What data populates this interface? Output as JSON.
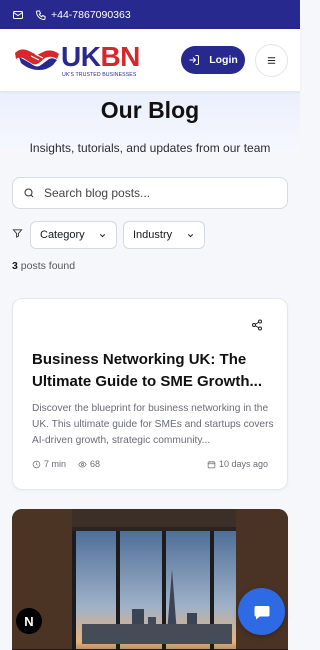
{
  "topbar": {
    "phone": "+44-7867090363",
    "icons": [
      "mail-icon",
      "phone-icon"
    ]
  },
  "header": {
    "logo_text_uk": "UK",
    "logo_text_bn": "BN",
    "logo_tagline": "UK'S TRUSTED BUSINESSES",
    "login_label": "Login",
    "menu_icon": "hamburger-icon"
  },
  "hero": {
    "title": "Our Blog",
    "subtitle": "Insights, tutorials, and updates from our team"
  },
  "search": {
    "placeholder": "Search blog posts...",
    "value": ""
  },
  "filters": {
    "category_label": "Category",
    "industry_label": "Industry"
  },
  "results": {
    "count": "3",
    "label": "posts found"
  },
  "posts": [
    {
      "title": "Business Networking UK: The Ultimate Guide to SME Growth...",
      "excerpt": "Discover the blueprint for business networking in the UK. This ultimate guide for SMEs and startups covers AI-driven growth, strategic community...",
      "read_time": "7 min",
      "views": "68",
      "date": "10 days ago"
    }
  ],
  "colors": {
    "brand_navy": "#27298f",
    "brand_red": "#d6272d",
    "fab_blue": "#2f6ae5"
  },
  "next_badge": "N"
}
